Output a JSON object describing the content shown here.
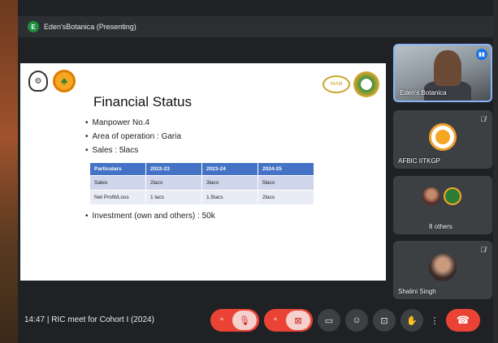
{
  "presenter": {
    "initial": "E",
    "label": "Eden'sBotanica (Presenting)"
  },
  "slide": {
    "title": "Financial Status",
    "bullets": [
      "Manpower No.4",
      "Area of operation : Garia",
      "Sales : 5lacs"
    ],
    "table": {
      "headers": [
        "Particulars",
        "2022-23",
        "2023-24",
        "2024-25"
      ],
      "rows": [
        [
          "Sales",
          "2lacs",
          "3lacs",
          "5lacs"
        ],
        [
          "Net Profit/Loss",
          "1 lacs",
          "1.5lacs",
          "2lacs"
        ]
      ]
    },
    "investment": "Investment (own and others) : 50k",
    "logo_nabard_text": "NIAM"
  },
  "participants": [
    {
      "name": "Eden's Botanica",
      "speaking": true
    },
    {
      "name": "AFBIC IITKGP",
      "muted": true
    },
    {
      "name": "8 others"
    },
    {
      "name": "Shalini Singh",
      "muted": true
    }
  ],
  "meeting": {
    "time": "14:47",
    "separator": "|",
    "title": "RIC meet for Cohort I (2024)"
  },
  "icons": {
    "mic": "mic-off-icon",
    "camera": "camera-off-icon",
    "captions": "captions-icon",
    "emoji": "emoji-icon",
    "present": "present-icon",
    "hand": "raise-hand-icon",
    "more": "more-vert-icon",
    "hangup": "hangup-icon"
  },
  "colors": {
    "table_header": "#4472c4",
    "hangup": "#ea4335",
    "speaking_border": "#8ab4f8"
  }
}
